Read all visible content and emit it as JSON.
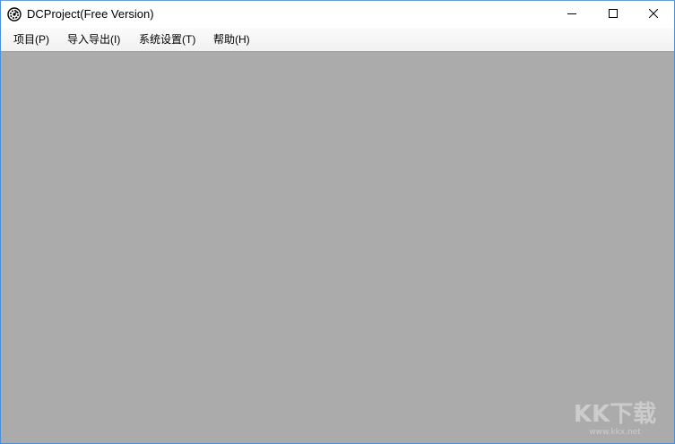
{
  "window": {
    "title": "DCProject(Free Version)",
    "app_icon": "gear-cog-icon",
    "controls": {
      "minimize_icon": "minimize-icon",
      "maximize_icon": "maximize-icon",
      "close_icon": "close-icon"
    }
  },
  "menu": {
    "items": [
      {
        "label": "项目(P)"
      },
      {
        "label": "导入导出(I)"
      },
      {
        "label": "系统设置(T)"
      },
      {
        "label": "帮助(H)"
      }
    ]
  },
  "workspace": {
    "background_color": "#ababab"
  },
  "colors": {
    "window_border": "#4a90d9",
    "titlebar": "#ffffff",
    "menubar": "#f5f5f5"
  }
}
